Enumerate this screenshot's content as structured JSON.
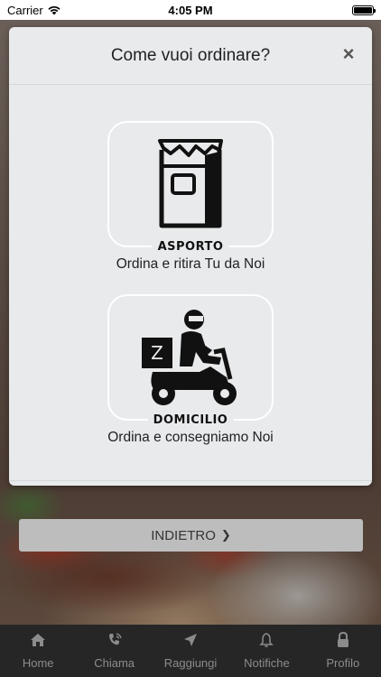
{
  "status_bar": {
    "carrier": "Carrier",
    "time": "4:05 PM"
  },
  "modal": {
    "title": "Come vuoi ordinare?",
    "close_icon": "close-icon",
    "options": [
      {
        "tag": "ASPORTO",
        "description": "Ordina e ritira Tu da Noi",
        "icon": "takeaway-bag-icon"
      },
      {
        "tag": "DOMICILIO",
        "description": "Ordina e consegniamo Noi",
        "icon": "delivery-scooter-icon"
      }
    ]
  },
  "back_button": {
    "label": "INDIETRO",
    "icon": "chevron-right-icon"
  },
  "tab_bar": {
    "items": [
      {
        "label": "Home",
        "icon": "home-icon"
      },
      {
        "label": "Chiama",
        "icon": "phone-icon"
      },
      {
        "label": "Raggiungi",
        "icon": "location-arrow-icon"
      },
      {
        "label": "Notifiche",
        "icon": "bell-icon"
      },
      {
        "label": "Profilo",
        "icon": "lock-icon"
      }
    ]
  },
  "colors": {
    "modal_background": "#e9eaec",
    "tab_bar_background": "#262626",
    "tab_label": "#8c8c8c",
    "back_button_background": "#bdbdbd"
  }
}
